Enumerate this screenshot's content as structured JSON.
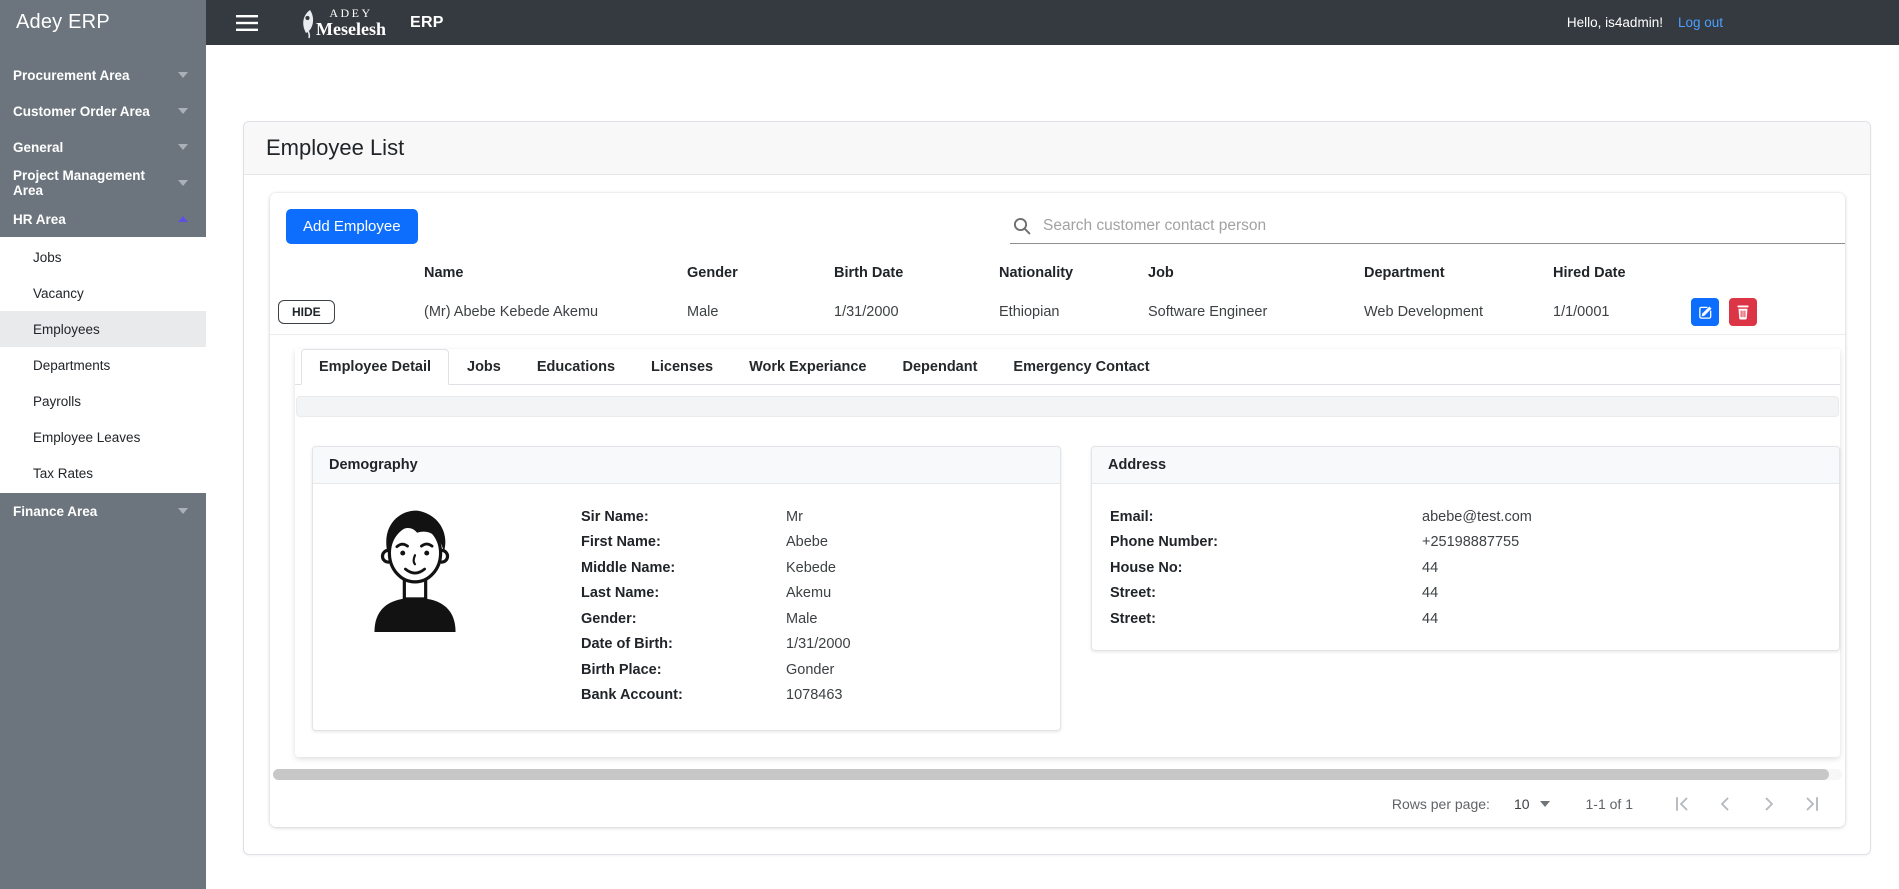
{
  "sidebar": {
    "title": "Adey ERP",
    "groups": [
      {
        "label": "Procurement Area",
        "expanded": false
      },
      {
        "label": "Customer Order Area",
        "expanded": false
      },
      {
        "label": "General",
        "expanded": false
      },
      {
        "label": "Project Management Area",
        "expanded": false
      },
      {
        "label": "HR Area",
        "expanded": true
      },
      {
        "label": "Finance Area",
        "expanded": false
      }
    ],
    "hr_submenu": {
      "items": [
        {
          "label": "Jobs",
          "active": false
        },
        {
          "label": "Vacancy",
          "active": false
        },
        {
          "label": "Employees",
          "active": true
        },
        {
          "label": "Departments",
          "active": false
        },
        {
          "label": "Payrolls",
          "active": false
        },
        {
          "label": "Employee Leaves",
          "active": false
        },
        {
          "label": "Tax Rates",
          "active": false
        }
      ]
    }
  },
  "topbar": {
    "brand_top": "ADEY",
    "brand_bottom": "Meselesh",
    "app_name": "ERP",
    "greeting": "Hello, is4admin!",
    "logout_label": "Log out"
  },
  "main": {
    "page_title": "Employee List",
    "add_button_label": "Add Employee",
    "search_placeholder": "Search customer contact person",
    "table": {
      "columns": [
        "Name",
        "Gender",
        "Birth Date",
        "Nationality",
        "Job",
        "Department",
        "Hired Date"
      ],
      "row": {
        "hide_label": "HIDE",
        "name": "(Mr) Abebe Kebede Akemu",
        "gender": "Male",
        "birth_date": "1/31/2000",
        "nationality": "Ethiopian",
        "job": "Software Engineer",
        "department": "Web Development",
        "hired_date": "1/1/0001"
      }
    },
    "tabs": [
      {
        "label": "Employee Detail",
        "active": true
      },
      {
        "label": "Jobs",
        "active": false
      },
      {
        "label": "Educations",
        "active": false
      },
      {
        "label": "Licenses",
        "active": false
      },
      {
        "label": "Work Experiance",
        "active": false
      },
      {
        "label": "Dependant",
        "active": false
      },
      {
        "label": "Emergency Contact",
        "active": false
      }
    ],
    "demography": {
      "title": "Demography",
      "fields": [
        {
          "label": "Sir Name:",
          "value": "Mr"
        },
        {
          "label": "First Name:",
          "value": "Abebe"
        },
        {
          "label": "Middle Name:",
          "value": "Kebede"
        },
        {
          "label": "Last Name:",
          "value": "Akemu"
        },
        {
          "label": "Gender:",
          "value": "Male"
        },
        {
          "label": "Date of Birth:",
          "value": "1/31/2000"
        },
        {
          "label": "Birth Place:",
          "value": "Gonder"
        },
        {
          "label": "Bank Account:",
          "value": "1078463"
        }
      ]
    },
    "address": {
      "title": "Address",
      "fields": [
        {
          "label": "Email:",
          "value": "abebe@test.com"
        },
        {
          "label": "Phone Number:",
          "value": "+25198887755"
        },
        {
          "label": "House No:",
          "value": "44"
        },
        {
          "label": "Street:",
          "value": "44"
        },
        {
          "label": "Street:",
          "value": "44"
        }
      ]
    },
    "pagination": {
      "rows_per_page_label": "Rows per page:",
      "rows_per_page_value": "10",
      "range_label": "1-1 of 1"
    }
  },
  "colors": {
    "primary": "#0d6efd",
    "danger": "#dc3545",
    "topbar_bg": "#343a40",
    "sidebar_bg": "#6c757d",
    "logout_link": "#4c9ffe",
    "expanded_caret": "#5a51e0"
  }
}
